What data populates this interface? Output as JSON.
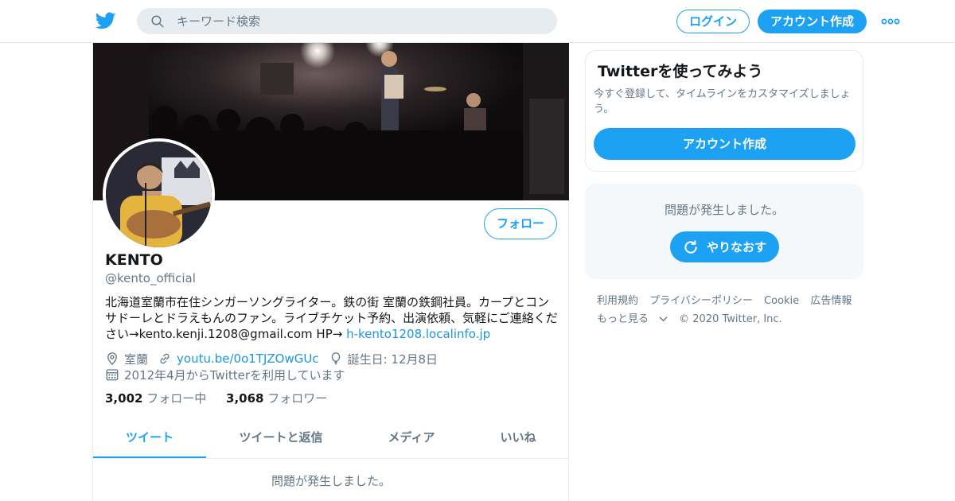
{
  "header": {
    "search_placeholder": "キーワード検索",
    "login_label": "ログイン",
    "signup_label": "アカウント作成"
  },
  "profile": {
    "name": "KENTO",
    "handle": "@kento_official",
    "bio_text": "北海道室蘭市在住シンガーソングライター。鉄の街 室蘭の鉄鋼社員。カープとコンサドーレとドラえもんのファン。ライブチケット予約、出演依頼、気軽にご連絡ください→kento.kenji.1208@gmail.com HP→ ",
    "bio_link": "h-kento1208.localinfo.jp",
    "location": "室蘭",
    "website": "youtu.be/0o1TJZOwGUc",
    "birthday": "誕生日: 12月8日",
    "joined": "2012年4月からTwitterを利用しています",
    "following_count": "3,002",
    "following_label": "フォロー中",
    "followers_count": "3,068",
    "followers_label": "フォロワー",
    "follow_button": "フォロー",
    "tabs": [
      "ツイート",
      "ツイートと返信",
      "メディア",
      "いいね"
    ],
    "feed_error": "問題が発生しました。"
  },
  "sidebar": {
    "signup_title": "Twitterを使ってみよう",
    "signup_desc": "今すぐ登録して、タイムラインをカスタマイズしましょう。",
    "signup_button": "アカウント作成",
    "error_message": "問題が発生しました。",
    "retry_button": "やりなおす"
  },
  "footer": {
    "links": [
      "利用規約",
      "プライバシーポリシー",
      "Cookie",
      "広告情報",
      "もっと見る"
    ],
    "copyright": "© 2020 Twitter, Inc."
  },
  "colors": {
    "accent": "#1da1f2",
    "link": "#1b95e0",
    "muted": "#657786",
    "border": "#e6ecf0"
  }
}
